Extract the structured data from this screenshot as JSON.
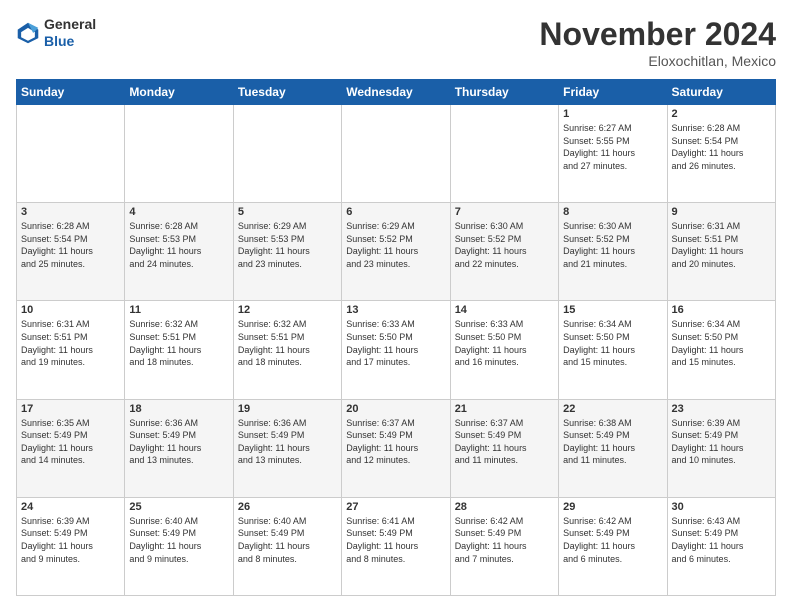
{
  "logo": {
    "general": "General",
    "blue": "Blue"
  },
  "header": {
    "title": "November 2024",
    "location": "Eloxochitlan, Mexico"
  },
  "weekdays": [
    "Sunday",
    "Monday",
    "Tuesday",
    "Wednesday",
    "Thursday",
    "Friday",
    "Saturday"
  ],
  "weeks": [
    [
      {
        "day": "",
        "info": ""
      },
      {
        "day": "",
        "info": ""
      },
      {
        "day": "",
        "info": ""
      },
      {
        "day": "",
        "info": ""
      },
      {
        "day": "",
        "info": ""
      },
      {
        "day": "1",
        "info": "Sunrise: 6:27 AM\nSunset: 5:55 PM\nDaylight: 11 hours\nand 27 minutes."
      },
      {
        "day": "2",
        "info": "Sunrise: 6:28 AM\nSunset: 5:54 PM\nDaylight: 11 hours\nand 26 minutes."
      }
    ],
    [
      {
        "day": "3",
        "info": "Sunrise: 6:28 AM\nSunset: 5:54 PM\nDaylight: 11 hours\nand 25 minutes."
      },
      {
        "day": "4",
        "info": "Sunrise: 6:28 AM\nSunset: 5:53 PM\nDaylight: 11 hours\nand 24 minutes."
      },
      {
        "day": "5",
        "info": "Sunrise: 6:29 AM\nSunset: 5:53 PM\nDaylight: 11 hours\nand 23 minutes."
      },
      {
        "day": "6",
        "info": "Sunrise: 6:29 AM\nSunset: 5:52 PM\nDaylight: 11 hours\nand 23 minutes."
      },
      {
        "day": "7",
        "info": "Sunrise: 6:30 AM\nSunset: 5:52 PM\nDaylight: 11 hours\nand 22 minutes."
      },
      {
        "day": "8",
        "info": "Sunrise: 6:30 AM\nSunset: 5:52 PM\nDaylight: 11 hours\nand 21 minutes."
      },
      {
        "day": "9",
        "info": "Sunrise: 6:31 AM\nSunset: 5:51 PM\nDaylight: 11 hours\nand 20 minutes."
      }
    ],
    [
      {
        "day": "10",
        "info": "Sunrise: 6:31 AM\nSunset: 5:51 PM\nDaylight: 11 hours\nand 19 minutes."
      },
      {
        "day": "11",
        "info": "Sunrise: 6:32 AM\nSunset: 5:51 PM\nDaylight: 11 hours\nand 18 minutes."
      },
      {
        "day": "12",
        "info": "Sunrise: 6:32 AM\nSunset: 5:51 PM\nDaylight: 11 hours\nand 18 minutes."
      },
      {
        "day": "13",
        "info": "Sunrise: 6:33 AM\nSunset: 5:50 PM\nDaylight: 11 hours\nand 17 minutes."
      },
      {
        "day": "14",
        "info": "Sunrise: 6:33 AM\nSunset: 5:50 PM\nDaylight: 11 hours\nand 16 minutes."
      },
      {
        "day": "15",
        "info": "Sunrise: 6:34 AM\nSunset: 5:50 PM\nDaylight: 11 hours\nand 15 minutes."
      },
      {
        "day": "16",
        "info": "Sunrise: 6:34 AM\nSunset: 5:50 PM\nDaylight: 11 hours\nand 15 minutes."
      }
    ],
    [
      {
        "day": "17",
        "info": "Sunrise: 6:35 AM\nSunset: 5:49 PM\nDaylight: 11 hours\nand 14 minutes."
      },
      {
        "day": "18",
        "info": "Sunrise: 6:36 AM\nSunset: 5:49 PM\nDaylight: 11 hours\nand 13 minutes."
      },
      {
        "day": "19",
        "info": "Sunrise: 6:36 AM\nSunset: 5:49 PM\nDaylight: 11 hours\nand 13 minutes."
      },
      {
        "day": "20",
        "info": "Sunrise: 6:37 AM\nSunset: 5:49 PM\nDaylight: 11 hours\nand 12 minutes."
      },
      {
        "day": "21",
        "info": "Sunrise: 6:37 AM\nSunset: 5:49 PM\nDaylight: 11 hours\nand 11 minutes."
      },
      {
        "day": "22",
        "info": "Sunrise: 6:38 AM\nSunset: 5:49 PM\nDaylight: 11 hours\nand 11 minutes."
      },
      {
        "day": "23",
        "info": "Sunrise: 6:39 AM\nSunset: 5:49 PM\nDaylight: 11 hours\nand 10 minutes."
      }
    ],
    [
      {
        "day": "24",
        "info": "Sunrise: 6:39 AM\nSunset: 5:49 PM\nDaylight: 11 hours\nand 9 minutes."
      },
      {
        "day": "25",
        "info": "Sunrise: 6:40 AM\nSunset: 5:49 PM\nDaylight: 11 hours\nand 9 minutes."
      },
      {
        "day": "26",
        "info": "Sunrise: 6:40 AM\nSunset: 5:49 PM\nDaylight: 11 hours\nand 8 minutes."
      },
      {
        "day": "27",
        "info": "Sunrise: 6:41 AM\nSunset: 5:49 PM\nDaylight: 11 hours\nand 8 minutes."
      },
      {
        "day": "28",
        "info": "Sunrise: 6:42 AM\nSunset: 5:49 PM\nDaylight: 11 hours\nand 7 minutes."
      },
      {
        "day": "29",
        "info": "Sunrise: 6:42 AM\nSunset: 5:49 PM\nDaylight: 11 hours\nand 6 minutes."
      },
      {
        "day": "30",
        "info": "Sunrise: 6:43 AM\nSunset: 5:49 PM\nDaylight: 11 hours\nand 6 minutes."
      }
    ]
  ]
}
